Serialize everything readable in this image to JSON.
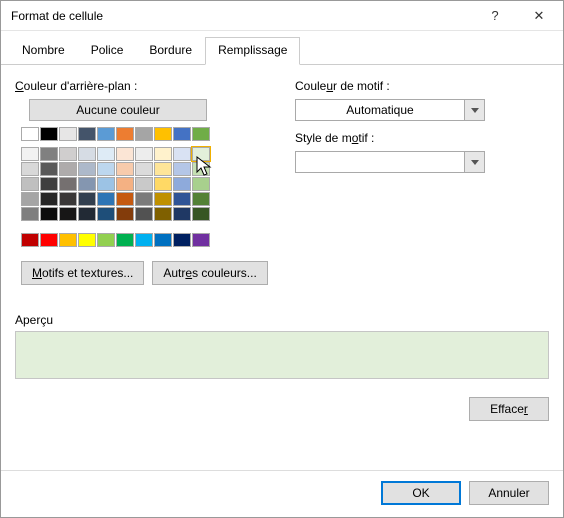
{
  "window": {
    "title": "Format de cellule",
    "help_icon": "?",
    "close_icon": "✕"
  },
  "tabs": {
    "number": "Nombre",
    "font": "Police",
    "border": "Bordure",
    "fill": "Remplissage"
  },
  "fill": {
    "bg_label_pre": "",
    "bg_label_u": "C",
    "bg_label_post": "ouleur d'arrière-plan :",
    "no_color": "Aucune couleur",
    "theme_row1": [
      "#ffffff",
      "#000000",
      "#e7e6e6",
      "#44546a",
      "#5b9bd5",
      "#ed7d31",
      "#a5a5a5",
      "#ffc000",
      "#4472c4",
      "#70ad47"
    ],
    "theme_shades": [
      [
        "#f2f2f2",
        "#808080",
        "#d0cece",
        "#d6dce4",
        "#deebf6",
        "#fbe5d5",
        "#ededed",
        "#fff2cc",
        "#d9e2f3",
        "#e2efda"
      ],
      [
        "#d8d8d8",
        "#595959",
        "#aeabab",
        "#adb9ca",
        "#bdd7ee",
        "#f7cbac",
        "#dbdbdb",
        "#fee599",
        "#b4c6e7",
        "#c5e0b3"
      ],
      [
        "#bfbfbf",
        "#3f3f3f",
        "#757070",
        "#8496b0",
        "#9cc3e5",
        "#f4b183",
        "#c9c9c9",
        "#ffd965",
        "#8eaadb",
        "#a8d08d"
      ],
      [
        "#a5a5a5",
        "#262626",
        "#3a3838",
        "#323f4f",
        "#2e75b5",
        "#c55a11",
        "#7b7b7b",
        "#bf9000",
        "#2f5496",
        "#538135"
      ],
      [
        "#7f7f7f",
        "#0c0c0c",
        "#171616",
        "#222a35",
        "#1e4e79",
        "#833c0b",
        "#525252",
        "#7f6000",
        "#1f3864",
        "#375623"
      ]
    ],
    "standard": [
      "#c00000",
      "#ff0000",
      "#ffc000",
      "#ffff00",
      "#92d050",
      "#00b050",
      "#00b0f0",
      "#0070c0",
      "#002060",
      "#7030a0"
    ],
    "motifs_btn_u": "M",
    "motifs_btn_post": "otifs et textures...",
    "other_btn_pre": "Autr",
    "other_btn_u": "e",
    "other_btn_post": "s couleurs..."
  },
  "pattern": {
    "color_label_pre": "Coule",
    "color_label_u": "u",
    "color_label_post": "r de motif :",
    "color_value": "Automatique",
    "style_label_pre": "Style de m",
    "style_label_u": "o",
    "style_label_post": "tif :",
    "style_value": ""
  },
  "preview": {
    "label": "Aperçu",
    "color": "#e2efda"
  },
  "buttons": {
    "clear_pre": "Efface",
    "clear_u": "r",
    "ok": "OK",
    "cancel": "Annuler"
  }
}
